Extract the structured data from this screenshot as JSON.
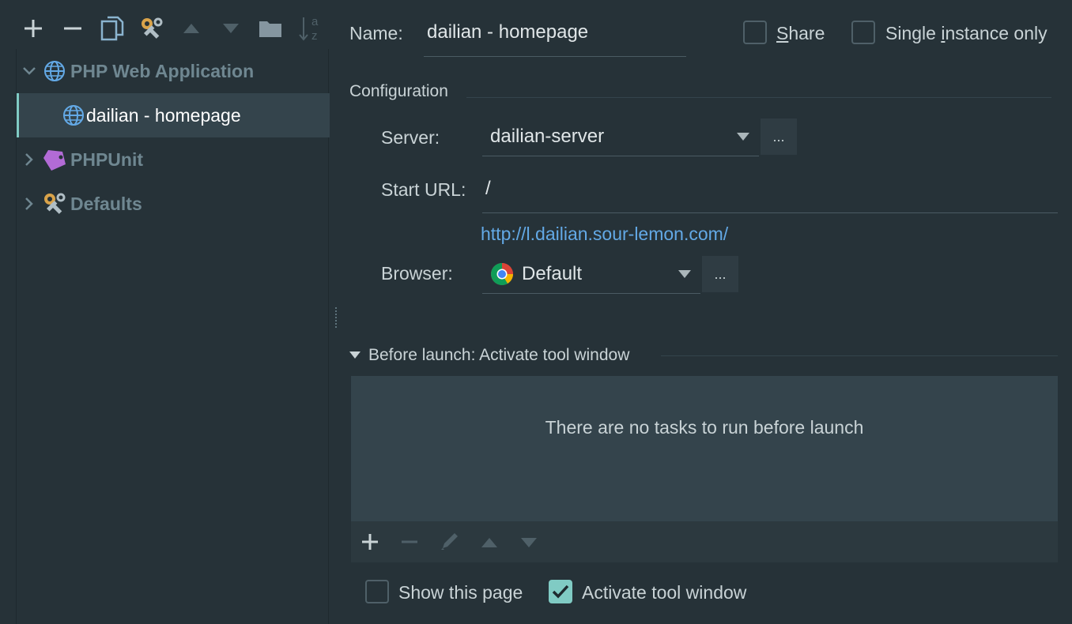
{
  "toolbar": {
    "icons": [
      "plus-icon",
      "minus-icon",
      "copy-icon",
      "wrench-icon",
      "move-up-icon",
      "move-down-icon",
      "folder-icon",
      "sort-az-icon"
    ],
    "sort_letters_top": "a",
    "sort_letters_bottom": "z"
  },
  "tree": {
    "group_php_web": "PHP Web Application",
    "item_selected": "dailian - homepage",
    "group_phpunit": "PHPUnit",
    "group_defaults": "Defaults"
  },
  "form": {
    "name_label": "Name:",
    "name_value": "dailian - homepage",
    "share_label_prefix": "",
    "share_mnemonic": "S",
    "share_label_rest": "hare",
    "single_label_prefix": "Single ",
    "single_mnemonic": "i",
    "single_label_rest": "nstance only",
    "configuration_heading": "Configuration",
    "server_label": "Server:",
    "server_value": "dailian-server",
    "server_more": "...",
    "start_url_label": "Start URL:",
    "start_url_value": "/",
    "start_url_link": "http://l.dailian.sour-lemon.com/",
    "browser_label": "Browser:",
    "browser_value": "Default",
    "browser_more": "..."
  },
  "before_launch": {
    "heading": "Before launch: Activate tool window",
    "empty_message": "There are no tasks to run before launch",
    "toolbar_icons": [
      "plus-icon",
      "minus-icon",
      "edit-icon",
      "move-up-icon",
      "move-down-icon"
    ]
  },
  "footer": {
    "show_page_label": "Show this page",
    "show_page_checked": false,
    "activate_label": "Activate tool window",
    "activate_checked": true,
    "share_checked": false,
    "single_checked": false
  },
  "colors": {
    "background": "#263238",
    "accent": "#80cbc4",
    "link": "#63a9e6",
    "selection": "#34444c"
  }
}
